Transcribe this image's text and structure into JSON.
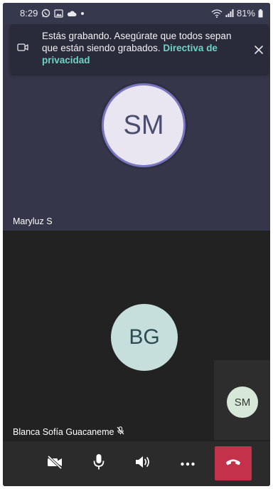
{
  "status_bar": {
    "time": "8:29",
    "battery": "81%"
  },
  "banner": {
    "message": "Estás grabando. Asegúrate que todos sepan que están siendo grabados.",
    "link": "Directiva de privacidad"
  },
  "participants": {
    "top": {
      "initials": "SM",
      "name": "Maryluz S"
    },
    "bottom": {
      "initials": "BG",
      "name": "Blanca Sofía Guacaneme"
    },
    "self": {
      "initials": "SM"
    }
  },
  "colors": {
    "top_tile_bg": "#35364a",
    "bottom_tile_bg": "#222222",
    "end_call_red": "#c4314b",
    "link_teal": "#6ed3c5"
  },
  "icons": {
    "banner": "video-camera-icon",
    "close": "close-icon",
    "muted": "mic-off-icon",
    "camera": "camera-off-icon",
    "mic": "microphone-icon",
    "speaker": "speaker-icon",
    "more": "more-options-icon",
    "end": "end-call-icon"
  }
}
